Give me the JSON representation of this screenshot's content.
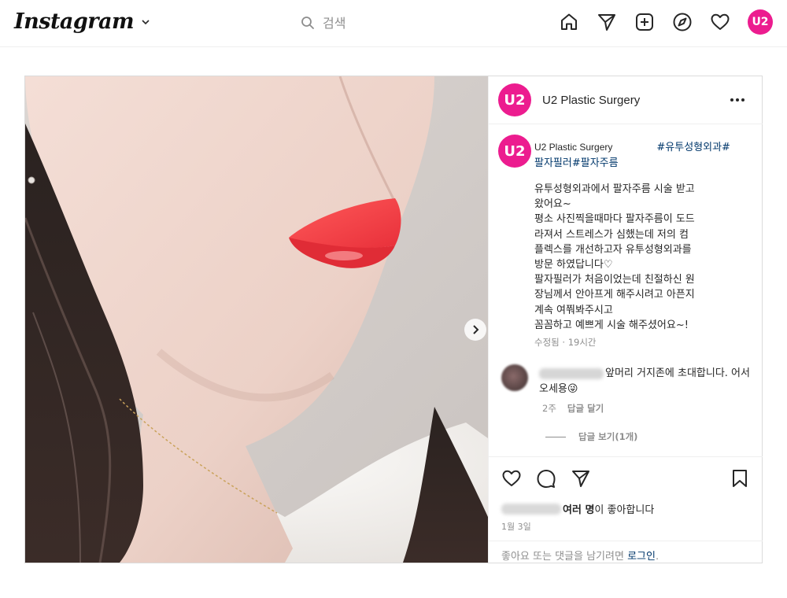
{
  "topbar": {
    "brand": "Instagram",
    "search_placeholder": "검색",
    "icons": [
      "home-icon",
      "direct-icon",
      "new-post-icon",
      "explore-icon",
      "activity-icon"
    ],
    "profile_initials": "U2"
  },
  "post": {
    "account_name": "U2 Plastic Surgery",
    "avatar_initials": "U2",
    "caption": {
      "username": "U2 Plastic Surgery",
      "hashtag_line1": "#유투성형외과#",
      "hashtag_line2": "팔자필러#팔자주름",
      "body": "유투성형외과에서 팔자주름 시술 받고\n왔어요~\n평소 사진찍을때마다 팔자주름이 도드\n라져서 스트레스가 심했는데 저의 컴\n플렉스를 개선하고자 유투성형외과를\n방문 하였답니다♡\n팔자필러가 처음이었는데 친절하신 원\n장님께서 안아프게 해주시려고 아픈지\n계속 여쭤봐주시고\n꼼꼼하고 예쁘게 시술 해주셨어요~!",
      "edited": "수정됨",
      "time": "19시간"
    },
    "comment": {
      "text": "앞머리 거지존에 초대합니다. 어서오세용😜",
      "age": "2주",
      "reply_label": "답글 달기",
      "view_replies": "답글 보기(1개)"
    },
    "likes_text": "여러 명",
    "likes_suffix": "이 좋아합니다",
    "date": "1월 3일",
    "login_prompt": "좋아요 또는 댓글을 남기려면",
    "login_link": "로그인",
    "login_period": "."
  },
  "colors": {
    "brand_pink": "#ec1c8f",
    "link": "#00376b",
    "muted": "#8e8e8e",
    "border": "#dbdbdb"
  }
}
